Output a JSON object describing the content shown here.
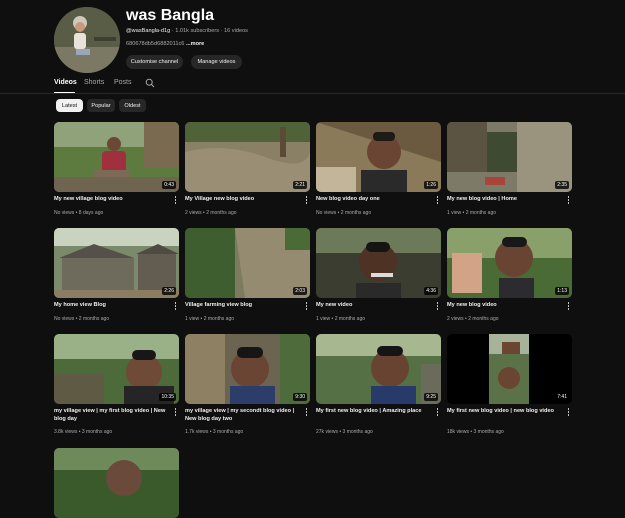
{
  "channel": {
    "name": "was Bangla",
    "handle": "@wasBangla-d1g",
    "stats": " · 1.01k subscribers · 16 videos",
    "description": "680678db5d6882011c6",
    "more_label": "...more",
    "customise_label": "Customise channel",
    "manage_label": "Manage videos"
  },
  "tabs": [
    "Videos",
    "Shorts",
    "Posts"
  ],
  "filters": [
    "Latest",
    "Popular",
    "Oldest"
  ],
  "videos": [
    {
      "title": "My new village blog video",
      "meta": "No views • 8 days ago",
      "duration": "0:43",
      "thumb": "field"
    },
    {
      "title": "My Village new blog video",
      "meta": "2 views • 2 months ago",
      "duration": "2:21",
      "thumb": "ground"
    },
    {
      "title": "New blog video day one",
      "meta": "No views • 2 months ago",
      "duration": "1:26",
      "thumb": "selfie-shed"
    },
    {
      "title": "My new blog video | Home",
      "meta": "1 view • 2 months ago",
      "duration": "2:35",
      "thumb": "yard"
    },
    {
      "title": "My home view Blog",
      "meta": "No views • 2 months ago",
      "duration": "2:26",
      "thumb": "house"
    },
    {
      "title": "Village farming view blog",
      "meta": "1 view • 2 months ago",
      "duration": "2:03",
      "thumb": "farm"
    },
    {
      "title": "My new video",
      "meta": "1 view • 2 months ago",
      "duration": "4:36",
      "thumb": "selfie-dark"
    },
    {
      "title": "My new blog video",
      "meta": "2 views • 2 months ago",
      "duration": "1:13",
      "thumb": "selfie-green"
    },
    {
      "title": "my village view | my first blog video | New blog day",
      "meta": "3.8k views • 3 months ago",
      "duration": "10:35",
      "thumb": "selfie-trees"
    },
    {
      "title": "my village view | my secondt blog video | New blog day two",
      "meta": "1.7k views • 3 months ago",
      "duration": "9:30",
      "thumb": "selfie-wall"
    },
    {
      "title": "My first new blog video | Amazing place",
      "meta": "27k views • 3 months ago",
      "duration": "9:25",
      "thumb": "selfie-outdoor"
    },
    {
      "title": "My first new blog video | new blog video",
      "meta": "18k views • 3 months ago",
      "duration": "7:41",
      "thumb": "vertical"
    }
  ]
}
